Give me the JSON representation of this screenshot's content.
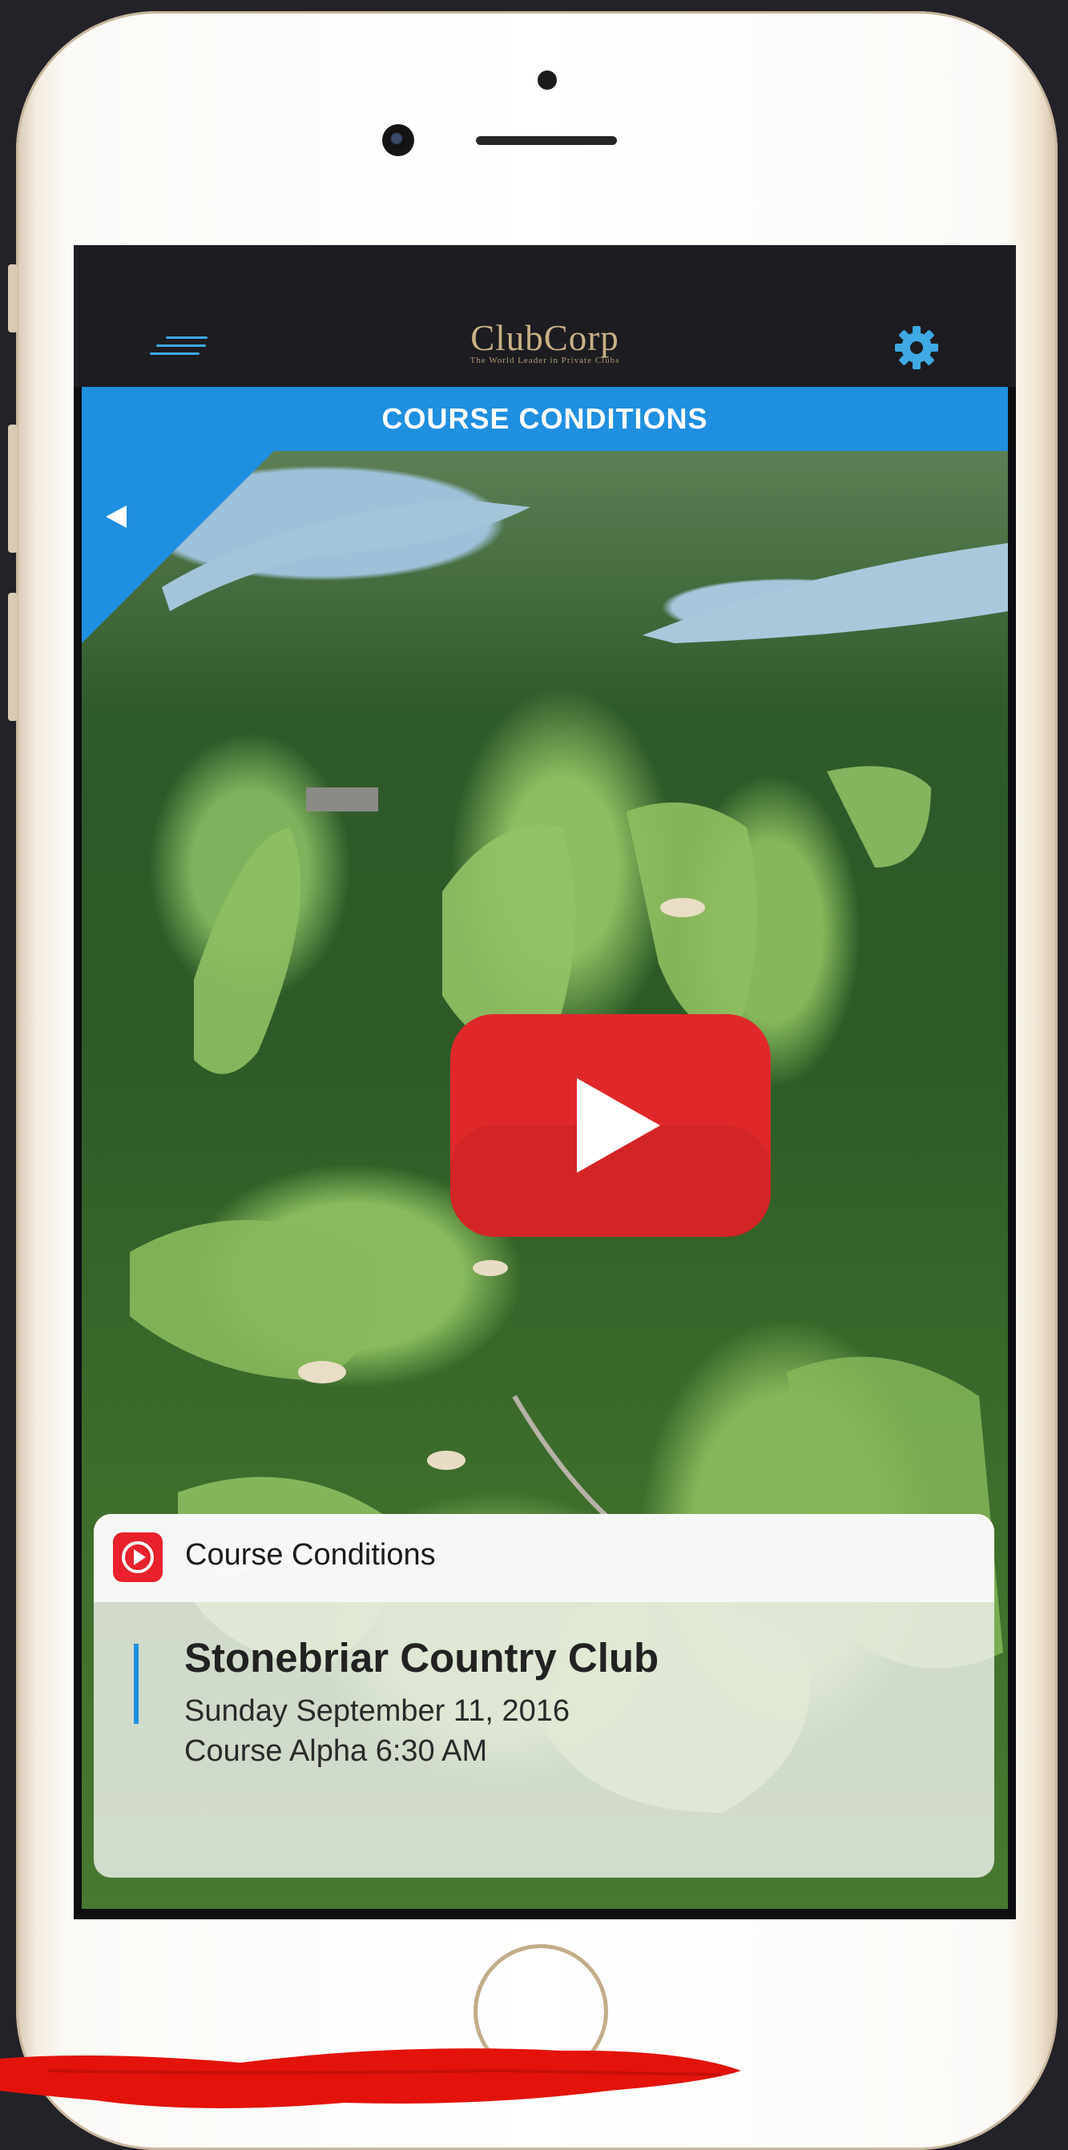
{
  "app": {
    "logo_text": "ClubCorp",
    "logo_tagline": "The World Leader in Private Clubs",
    "screen_title": "COURSE CONDITIONS"
  },
  "icons": {
    "menu": "menu-icon",
    "settings": "gear-icon",
    "back": "back-arrow-icon",
    "play": "play-icon",
    "card_app": "youtube-play-icon"
  },
  "colors": {
    "accent": "#1f8fe0",
    "gear": "#3fa9e3",
    "logo_gold": "#c9b184",
    "play_red": "#e0282a"
  },
  "card": {
    "app_label": "Course Conditions",
    "title": "Stonebriar Country Club",
    "date": "Sunday September 11, 2016",
    "detail": "Course Alpha 6:30 AM"
  }
}
